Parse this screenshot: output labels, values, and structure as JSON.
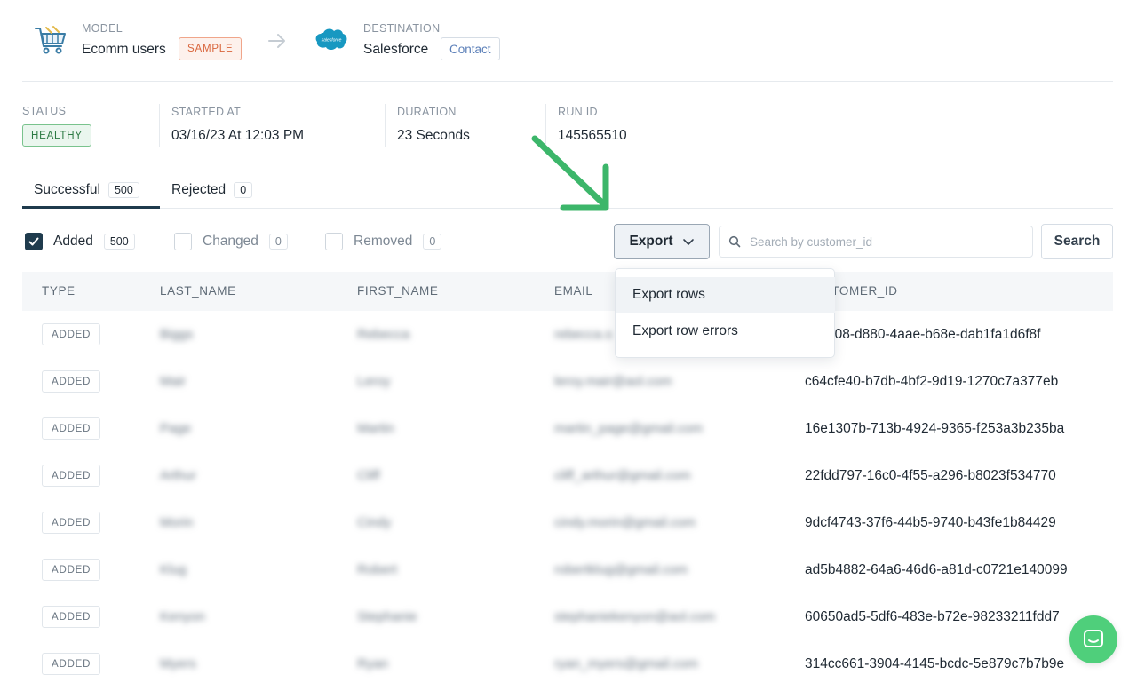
{
  "model": {
    "label": "MODEL",
    "name": "Ecomm users",
    "badge": "SAMPLE"
  },
  "destination": {
    "label": "DESTINATION",
    "name": "Salesforce",
    "object": "Contact",
    "logo_text": "salesforce"
  },
  "run_info": {
    "status_label": "STATUS",
    "status": "HEALTHY",
    "started_label": "STARTED AT",
    "started": "03/16/23 At 12:03 PM",
    "duration_label": "DURATION",
    "duration": "23 Seconds",
    "run_id_label": "RUN ID",
    "run_id": "145565510"
  },
  "tabs": [
    {
      "label": "Successful",
      "count": "500"
    },
    {
      "label": "Rejected",
      "count": "0"
    }
  ],
  "filters": [
    {
      "label": "Added",
      "count": "500",
      "checked": true
    },
    {
      "label": "Changed",
      "count": "0",
      "checked": false
    },
    {
      "label": "Removed",
      "count": "0",
      "checked": false
    }
  ],
  "export": {
    "label": "Export",
    "menu": [
      "Export rows",
      "Export row errors"
    ]
  },
  "search": {
    "placeholder": "Search by customer_id",
    "value": "",
    "button": "Search"
  },
  "table": {
    "headers": [
      "TYPE",
      "LAST_NAME",
      "FIRST_NAME",
      "EMAIL",
      "CUSTOMER_ID"
    ],
    "rows": [
      {
        "type": "ADDED",
        "last": "Biggs",
        "first": "Rebecca",
        "email": "rebecca.s",
        "id": "c94308-d880-4aae-b68e-dab1fa1d6f8f"
      },
      {
        "type": "ADDED",
        "last": "Mair",
        "first": "Leroy",
        "email": "leroy.mair@aol.com",
        "id": "c64cfe40-b7db-4bf2-9d19-1270c7a377eb"
      },
      {
        "type": "ADDED",
        "last": "Page",
        "first": "Martin",
        "email": "martin_page@gmail.com",
        "id": "16e1307b-713b-4924-9365-f253a3b235ba"
      },
      {
        "type": "ADDED",
        "last": "Arthur",
        "first": "Cliff",
        "email": "cliff_arthur@gmail.com",
        "id": "22fdd797-16c0-4f55-a296-b8023f534770"
      },
      {
        "type": "ADDED",
        "last": "Morin",
        "first": "Cindy",
        "email": "cindy.morin@gmail.com",
        "id": "9dcf4743-37f6-44b5-9740-b43fe1b84429"
      },
      {
        "type": "ADDED",
        "last": "Klug",
        "first": "Robert",
        "email": "robertklug@gmail.com",
        "id": "ad5b4882-64a6-46d6-a81d-c0721e140099"
      },
      {
        "type": "ADDED",
        "last": "Kenyon",
        "first": "Stephanie",
        "email": "stephaniekenyon@aol.com",
        "id": "60650ad5-5df6-483e-b72e-98233211fdd7"
      },
      {
        "type": "ADDED",
        "last": "Myers",
        "first": "Ryan",
        "email": "ryan_myers@gmail.com",
        "id": "314cc661-3904-4145-bcdc-5e879c7b7b9e"
      }
    ]
  }
}
